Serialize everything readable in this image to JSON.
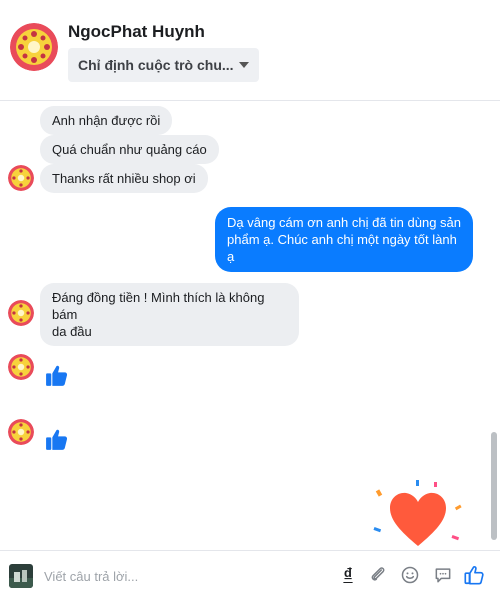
{
  "header": {
    "contact_name": "NgocPhat Huynh",
    "assign_label": "Chỉ định cuộc trò chu..."
  },
  "messages": {
    "m1": "Anh nhận được rồi",
    "m2": "Quá chuẩn như quảng cáo",
    "m3": "Thanks rất nhiều shop ơi",
    "m4_line1": "Dạ vâng cám ơn anh chị đã tin dùng sản",
    "m4_line2": "phẩm ạ. Chúc anh chị một ngày tốt lành ạ",
    "m5_line1": "Đáng đồng tiền ! Mình thích là không bám",
    "m5_line2": "da đầu"
  },
  "composer": {
    "placeholder": "Viết câu trả lời...",
    "currency_symbol": "₫"
  },
  "colors": {
    "brand_blue": "#0a7cff",
    "incoming_bubble": "#eceef1",
    "heart": "#ff5a3c"
  },
  "icons": [
    "profile-avatar-icon",
    "dropdown-caret-icon",
    "like-thumb-icon",
    "heart-sticker-icon",
    "currency-dong-icon",
    "paperclip-icon",
    "emoji-icon",
    "chat-bubble-icon",
    "thumbs-up-icon"
  ]
}
